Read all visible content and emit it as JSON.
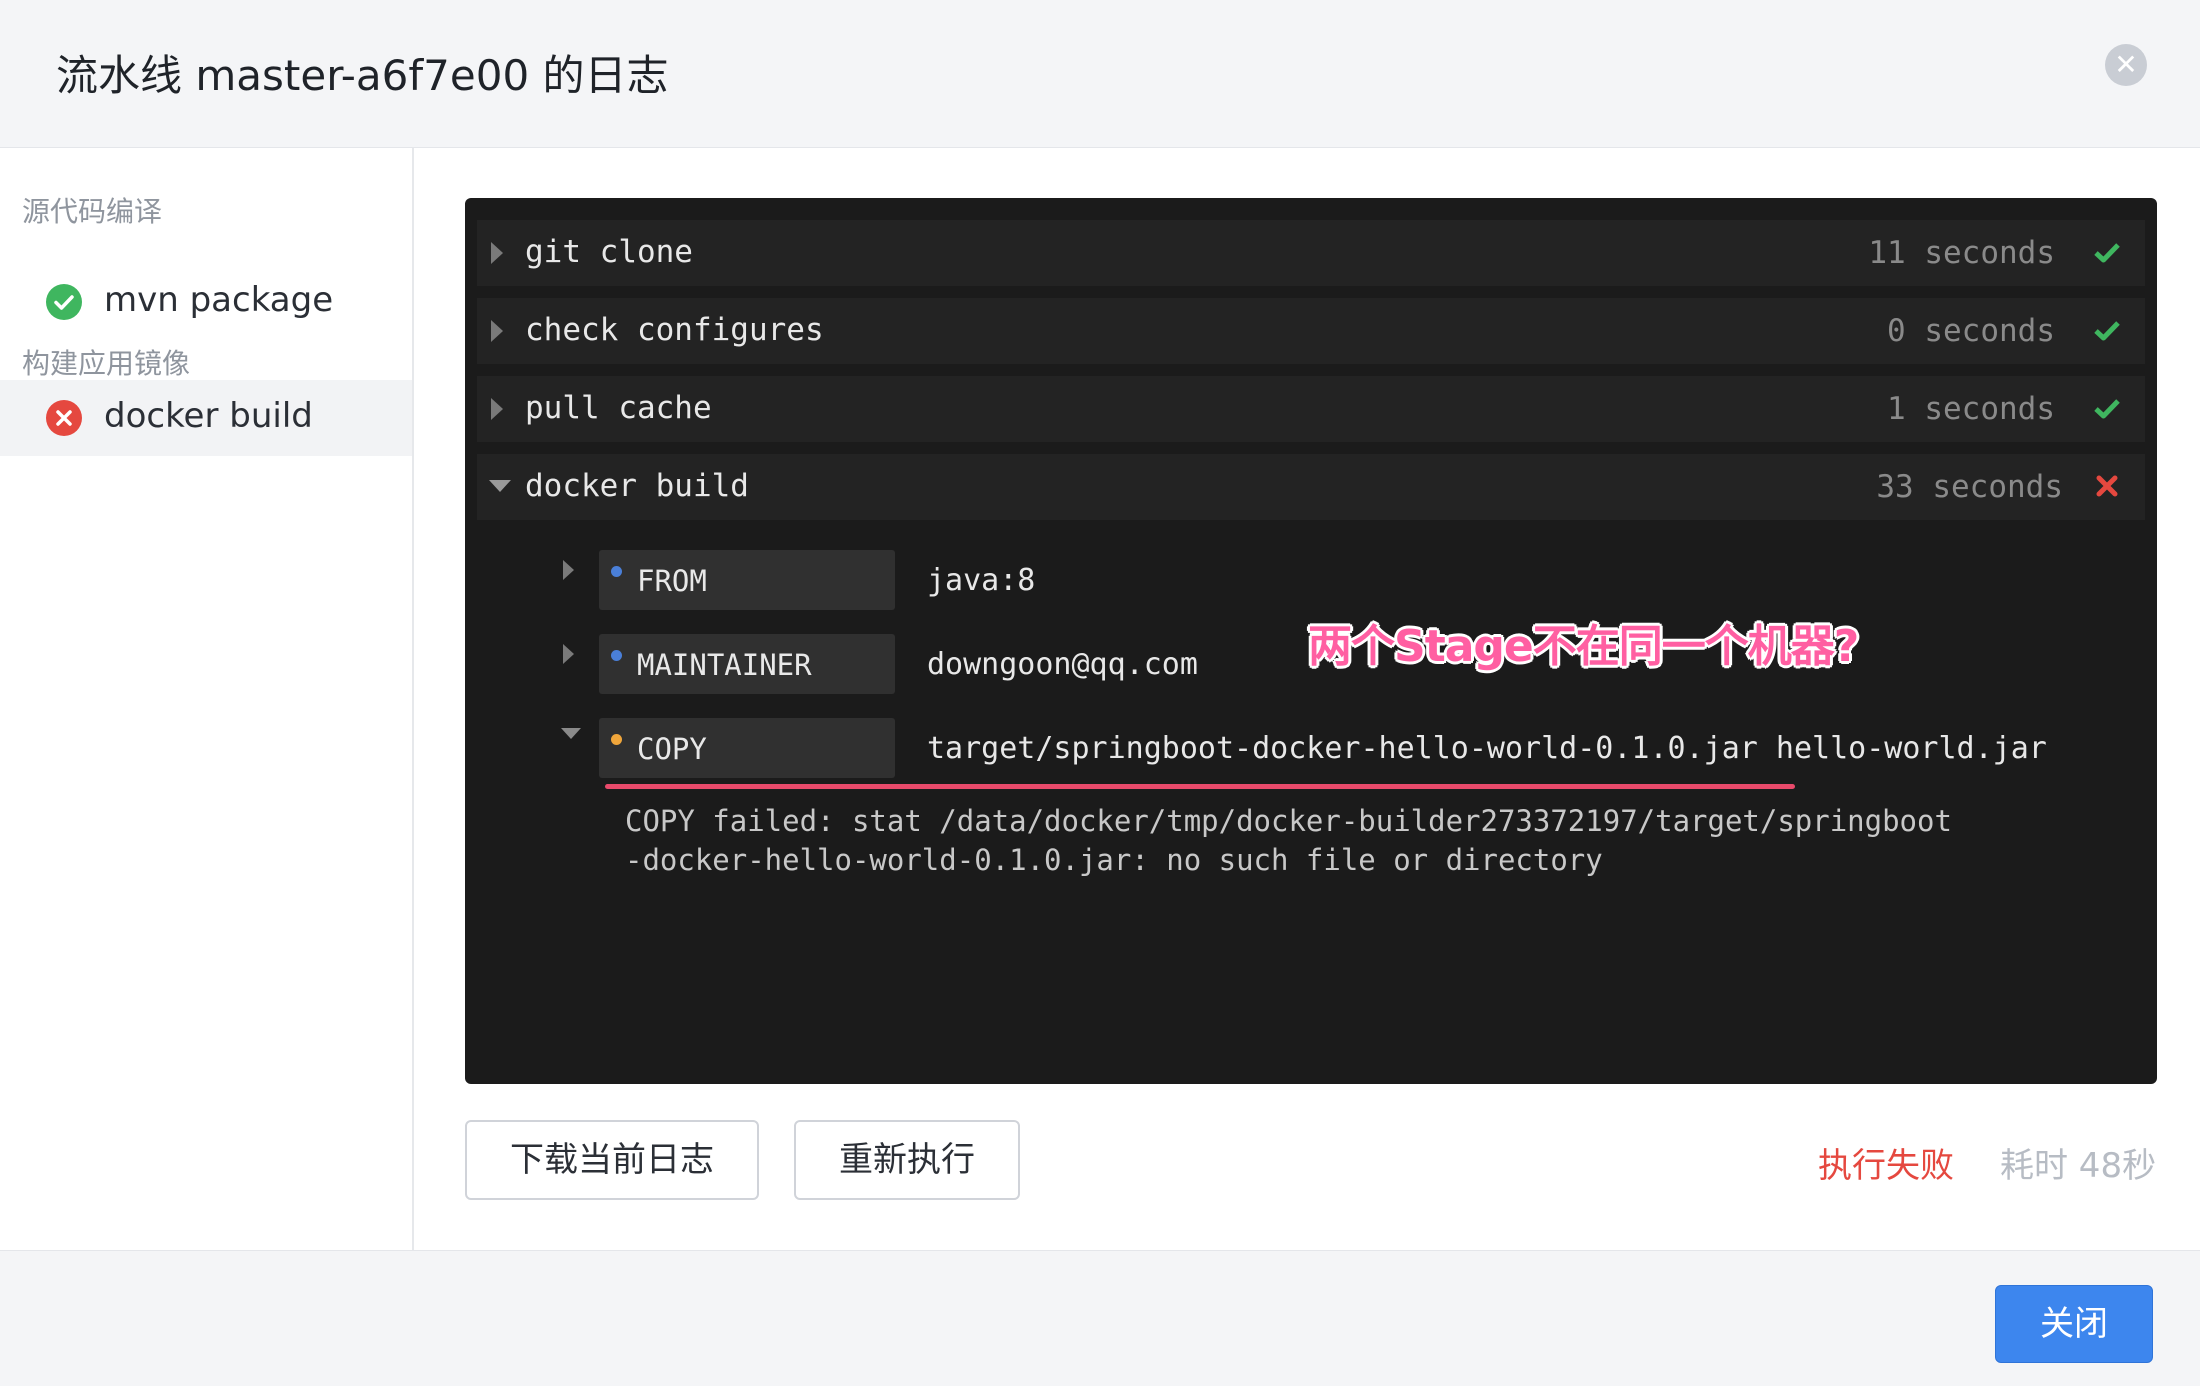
{
  "dialog": {
    "title": "流水线 master-a6f7e00 的日志",
    "close_icon": "close-icon"
  },
  "sidebar": {
    "groups": [
      {
        "title": "源代码编译",
        "items": [
          {
            "label": "mvn package",
            "status": "success"
          }
        ]
      },
      {
        "title": "构建应用镜像",
        "items": [
          {
            "label": "docker build",
            "status": "failed"
          }
        ]
      }
    ]
  },
  "console": {
    "stages": [
      {
        "name": "git clone",
        "time": "11 seconds",
        "status": "success",
        "expanded": false
      },
      {
        "name": "check configures",
        "time": "0 seconds",
        "status": "success",
        "expanded": false
      },
      {
        "name": "pull cache",
        "time": "1 seconds",
        "status": "success",
        "expanded": false
      },
      {
        "name": "docker build",
        "time": "33 seconds",
        "status": "failed",
        "expanded": true
      }
    ],
    "instructions": [
      {
        "keyword": "FROM",
        "arg": "java:8",
        "dot_color": "#4a7fd8",
        "expanded": false
      },
      {
        "keyword": "MAINTAINER",
        "arg": "downgoon@qq.com",
        "dot_color": "#4a7fd8",
        "expanded": false
      },
      {
        "keyword": "COPY",
        "arg": "target/springboot-docker-hello-world-0.1.0.jar hello-world.jar",
        "dot_color": "#f0a63b",
        "expanded": true
      }
    ],
    "error_lines": [
      "COPY failed: stat /data/docker/tmp/docker-builder273372197/target/springboot",
      "-docker-hello-world-0.1.0.jar: no such file or directory"
    ],
    "annotation": "两个Stage不在同一个机器?"
  },
  "actions": {
    "download_label": "下载当前日志",
    "rerun_label": "重新执行",
    "status_text": "执行失败",
    "duration_text": "耗时 48秒"
  },
  "footer": {
    "close_label": "关闭"
  },
  "colors": {
    "success": "#3fb65f",
    "failed": "#e5483f",
    "console_bg": "#1b1b1b",
    "primary": "#3d86ee"
  }
}
